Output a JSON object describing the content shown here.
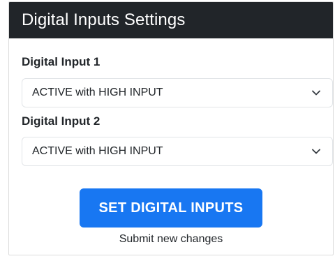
{
  "panel": {
    "title": "Digital Inputs Settings"
  },
  "inputs": [
    {
      "label": "Digital Input 1",
      "selected": "ACTIVE with HIGH INPUT"
    },
    {
      "label": "Digital Input 2",
      "selected": "ACTIVE with HIGH INPUT"
    }
  ],
  "actions": {
    "set_button_label": "SET DIGITAL INPUTS",
    "submit_note": "Submit new changes"
  },
  "colors": {
    "header_bg": "#212529",
    "button_bg": "#1877f2"
  },
  "icons": {
    "select_arrow": "chevron-down-icon"
  }
}
